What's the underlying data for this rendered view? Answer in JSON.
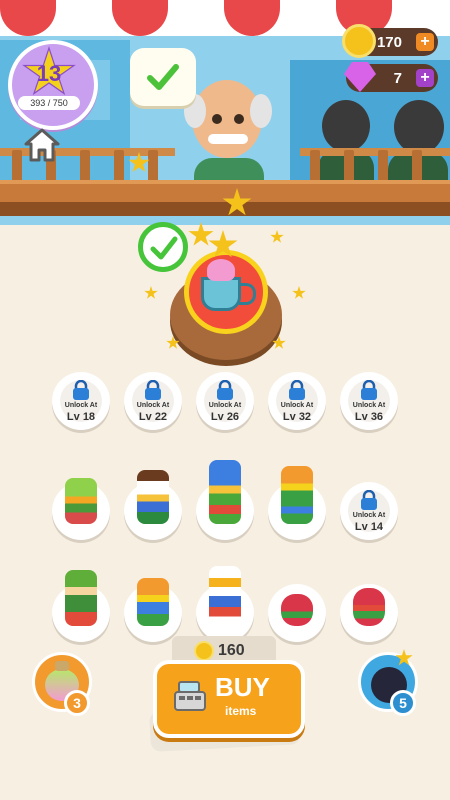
{
  "currency": {
    "coins": "170",
    "gems": "7",
    "coin_plus": "+",
    "gem_plus": "+"
  },
  "player": {
    "level": "13",
    "xp": "393 / 750"
  },
  "customer": {
    "order_status": "check-icon"
  },
  "locked_slots": [
    {
      "top": "Unlock At",
      "lv": "Lv 18"
    },
    {
      "top": "Unlock At",
      "lv": "Lv 22"
    },
    {
      "top": "Unlock At",
      "lv": "Lv 26"
    },
    {
      "top": "Unlock At",
      "lv": "Lv 32"
    },
    {
      "top": "Unlock At",
      "lv": "Lv 36"
    },
    {
      "top": "Unlock At",
      "lv": "Lv 14"
    }
  ],
  "food_items": [
    {
      "name": "green-fruit-stack"
    },
    {
      "name": "coconut-stack"
    },
    {
      "name": "blue-flower-stack"
    },
    {
      "name": "orange-slice-stack"
    },
    {
      "name": "kiwi-stack"
    },
    {
      "name": "orange-slice-stack-small"
    },
    {
      "name": "egg-stack"
    },
    {
      "name": "steak-plate"
    },
    {
      "name": "steak-plate-2"
    }
  ],
  "order_item": {
    "name": "cupcake-mug"
  },
  "shop": {
    "price": "160",
    "buy_label": "BUY",
    "buy_sub": "items"
  },
  "boosters": {
    "potion_count": "3",
    "bomb_count": "5"
  },
  "colors": {
    "accent": "#f7a21b",
    "level_badge": "#c9a0f0",
    "counter_bg": "#5c3a2a"
  }
}
